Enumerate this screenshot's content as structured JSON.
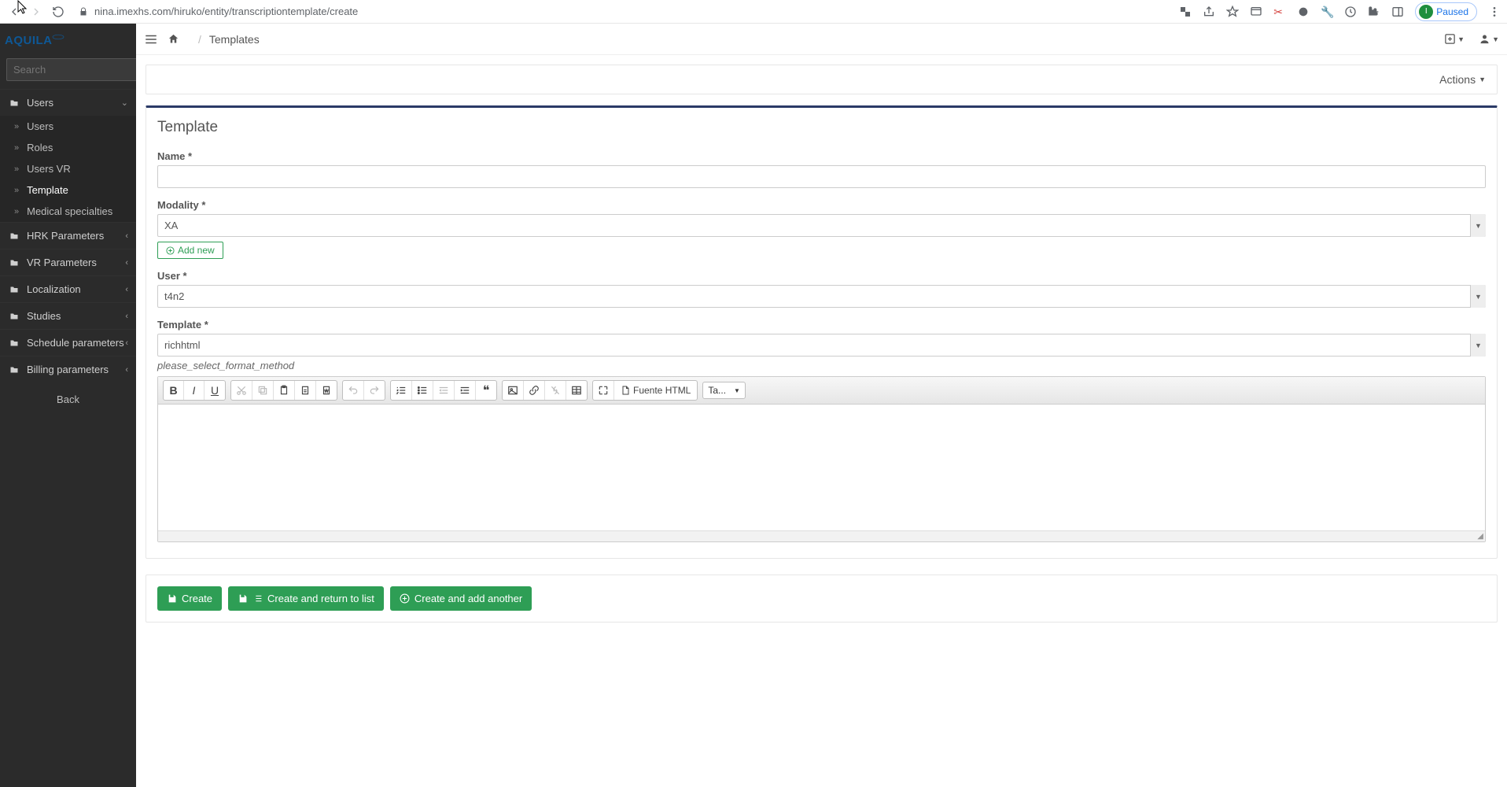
{
  "browser": {
    "url": "nina.imexhs.com/hiruko/entity/transcriptiontemplate/create",
    "paused_label": "Paused"
  },
  "brand": "AQUILA",
  "sidebar": {
    "search_placeholder": "Search",
    "sections": [
      {
        "label": "Users",
        "items": [
          "Users",
          "Roles",
          "Users VR",
          "Template",
          "Medical specialties"
        ],
        "active_index": 3
      },
      {
        "label": "HRK Parameters"
      },
      {
        "label": "VR Parameters"
      },
      {
        "label": "Localization"
      },
      {
        "label": "Studies"
      },
      {
        "label": "Schedule parameters"
      },
      {
        "label": "Billing parameters"
      }
    ],
    "back": "Back"
  },
  "breadcrumb": {
    "page": "Templates"
  },
  "actions_label": "Actions",
  "panel": {
    "title": "Template",
    "name_label": "Name *",
    "name_value": "",
    "modality_label": "Modality *",
    "modality_value": "XA",
    "add_new": "Add new",
    "user_label": "User *",
    "user_value": "t4n2",
    "template_label": "Template *",
    "template_value": "richhtml",
    "helper": "please_select_format_method"
  },
  "editor": {
    "source_label": "Fuente HTML",
    "size_select": "Ta..."
  },
  "buttons": {
    "create": "Create",
    "create_return": "Create and return to list",
    "create_another": "Create and add another"
  }
}
